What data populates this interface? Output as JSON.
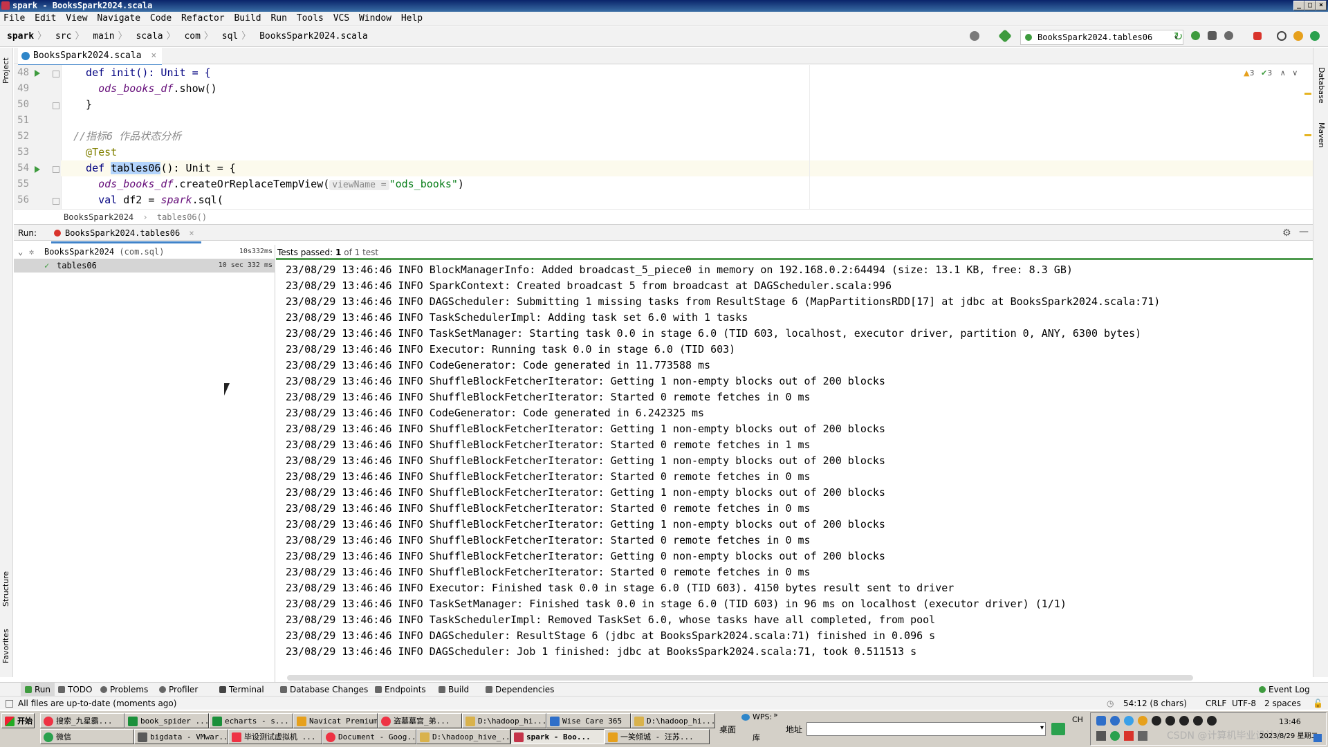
{
  "window": {
    "title": "spark - BooksSpark2024.scala",
    "min": "_",
    "max": "□",
    "close": "×"
  },
  "menu": [
    "File",
    "Edit",
    "View",
    "Navigate",
    "Code",
    "Refactor",
    "Build",
    "Run",
    "Tools",
    "VCS",
    "Window",
    "Help"
  ],
  "breadcrumb": [
    "spark",
    "src",
    "main",
    "scala",
    "com",
    "sql",
    "BooksSpark2024.scala"
  ],
  "run_config": "BooksSpark2024.tables06",
  "left_stripe": {
    "project": "Project",
    "structure": "Structure",
    "favorites": "Favorites"
  },
  "right_stripe": {
    "database": "Database",
    "maven": "Maven"
  },
  "editor": {
    "tab": "BooksSpark2024.scala",
    "inspections": {
      "warnings": "3",
      "weak": "3"
    },
    "lines": [
      {
        "num": "48",
        "text": "  def init(): Unit = {"
      },
      {
        "num": "49",
        "pre": "    ",
        "obj": "ods_books_df",
        "post": ".show()"
      },
      {
        "num": "50",
        "text": "  }"
      },
      {
        "num": "51",
        "text": ""
      },
      {
        "num": "52",
        "comment": "//指标6 作品状态分析"
      },
      {
        "num": "53",
        "annotation": "  @Test"
      },
      {
        "num": "54",
        "kw": "  def ",
        "selected": "tables06",
        "rest": "(): Unit = {"
      },
      {
        "num": "55",
        "pre": "    ",
        "obj": "ods_books_df",
        "mid": ".createOrReplaceTempView(",
        "hint": "viewName =",
        "str": "\"ods_books\"",
        "end": ")"
      },
      {
        "num": "56",
        "kw": "    val ",
        "rest": "df2 = ",
        "obj": "spark",
        "post": ".sql("
      }
    ],
    "crumb": [
      "BooksSpark2024",
      "tables06()"
    ]
  },
  "run": {
    "label": "Run:",
    "tab": "BooksSpark2024.tables06",
    "tests_passed_label": "Tests passed:",
    "tests_passed_count": "1",
    "tests_passed_suffix": "of 1 test",
    "tree": [
      {
        "name": "BooksSpark2024",
        "pkg": "(com.sql)",
        "time": "10s332ms"
      },
      {
        "name": "tables06",
        "time": "10 sec 332 ms"
      }
    ],
    "console": [
      "23/08/29 13:46:46 INFO BlockManagerInfo: Added broadcast_5_piece0 in memory on 192.168.0.2:64494 (size: 13.1 KB, free: 8.3 GB)",
      "23/08/29 13:46:46 INFO SparkContext: Created broadcast 5 from broadcast at DAGScheduler.scala:996",
      "23/08/29 13:46:46 INFO DAGScheduler: Submitting 1 missing tasks from ResultStage 6 (MapPartitionsRDD[17] at jdbc at BooksSpark2024.scala:71)",
      "23/08/29 13:46:46 INFO TaskSchedulerImpl: Adding task set 6.0 with 1 tasks",
      "23/08/29 13:46:46 INFO TaskSetManager: Starting task 0.0 in stage 6.0 (TID 603, localhost, executor driver, partition 0, ANY, 6300 bytes)",
      "23/08/29 13:46:46 INFO Executor: Running task 0.0 in stage 6.0 (TID 603)",
      "23/08/29 13:46:46 INFO CodeGenerator: Code generated in 11.773588 ms",
      "23/08/29 13:46:46 INFO ShuffleBlockFetcherIterator: Getting 1 non-empty blocks out of 200 blocks",
      "23/08/29 13:46:46 INFO ShuffleBlockFetcherIterator: Started 0 remote fetches in 0 ms",
      "23/08/29 13:46:46 INFO CodeGenerator: Code generated in 6.242325 ms",
      "23/08/29 13:46:46 INFO ShuffleBlockFetcherIterator: Getting 1 non-empty blocks out of 200 blocks",
      "23/08/29 13:46:46 INFO ShuffleBlockFetcherIterator: Started 0 remote fetches in 1 ms",
      "23/08/29 13:46:46 INFO ShuffleBlockFetcherIterator: Getting 1 non-empty blocks out of 200 blocks",
      "23/08/29 13:46:46 INFO ShuffleBlockFetcherIterator: Started 0 remote fetches in 0 ms",
      "23/08/29 13:46:46 INFO ShuffleBlockFetcherIterator: Getting 1 non-empty blocks out of 200 blocks",
      "23/08/29 13:46:46 INFO ShuffleBlockFetcherIterator: Started 0 remote fetches in 0 ms",
      "23/08/29 13:46:46 INFO ShuffleBlockFetcherIterator: Getting 1 non-empty blocks out of 200 blocks",
      "23/08/29 13:46:46 INFO ShuffleBlockFetcherIterator: Started 0 remote fetches in 0 ms",
      "23/08/29 13:46:46 INFO ShuffleBlockFetcherIterator: Getting 0 non-empty blocks out of 200 blocks",
      "23/08/29 13:46:46 INFO ShuffleBlockFetcherIterator: Started 0 remote fetches in 0 ms",
      "23/08/29 13:46:46 INFO Executor: Finished task 0.0 in stage 6.0 (TID 603). 4150 bytes result sent to driver",
      "23/08/29 13:46:46 INFO TaskSetManager: Finished task 0.0 in stage 6.0 (TID 603) in 96 ms on localhost (executor driver) (1/1)",
      "23/08/29 13:46:46 INFO TaskSchedulerImpl: Removed TaskSet 6.0, whose tasks have all completed, from pool",
      "23/08/29 13:46:46 INFO DAGScheduler: ResultStage 6 (jdbc at BooksSpark2024.scala:71) finished in 0.096 s",
      "23/08/29 13:46:46 INFO DAGScheduler: Job 1 finished: jdbc at BooksSpark2024.scala:71, took 0.511513 s"
    ]
  },
  "tool_windows": [
    "Run",
    "TODO",
    "Problems",
    "Profiler",
    "Terminal",
    "Database Changes",
    "Endpoints",
    "Build",
    "Dependencies"
  ],
  "event_log": "Event Log",
  "status": {
    "message": "All files are up-to-date (moments ago)",
    "position": "54:12 (8 chars)",
    "line_sep": "CRLF",
    "encoding": "UTF-8",
    "indent": "2 spaces"
  },
  "taskbar": {
    "start": "开始",
    "row1": [
      "搜索_九星霸...",
      "book_spider ...",
      "echarts - s...",
      "Navicat Premium",
      "盗墓墓宫_弟...",
      "D:\\hadoop_hi...",
      "Wise Care 365",
      "D:\\hadoop_hi..."
    ],
    "row2": [
      "微信",
      "bigdata - VMwar...",
      "毕设测试虚拟机 ...",
      "Document - Goog...",
      "D:\\hadoop_hive_...",
      "spark - Boo...",
      "一笑倾城 - 汪苏..."
    ],
    "desktop": "桌面",
    "address": "地址",
    "wps": "WPS:",
    "ku": "库",
    "lang": "CH",
    "time": "13:46",
    "date": "2023/8/29 星期二",
    "watermark": "CSDN @计算机毕业设计小"
  },
  "colors": {
    "accent": "#4083c9",
    "pass": "#4e9a4e",
    "keyword": "#000080",
    "string": "#067d17"
  }
}
